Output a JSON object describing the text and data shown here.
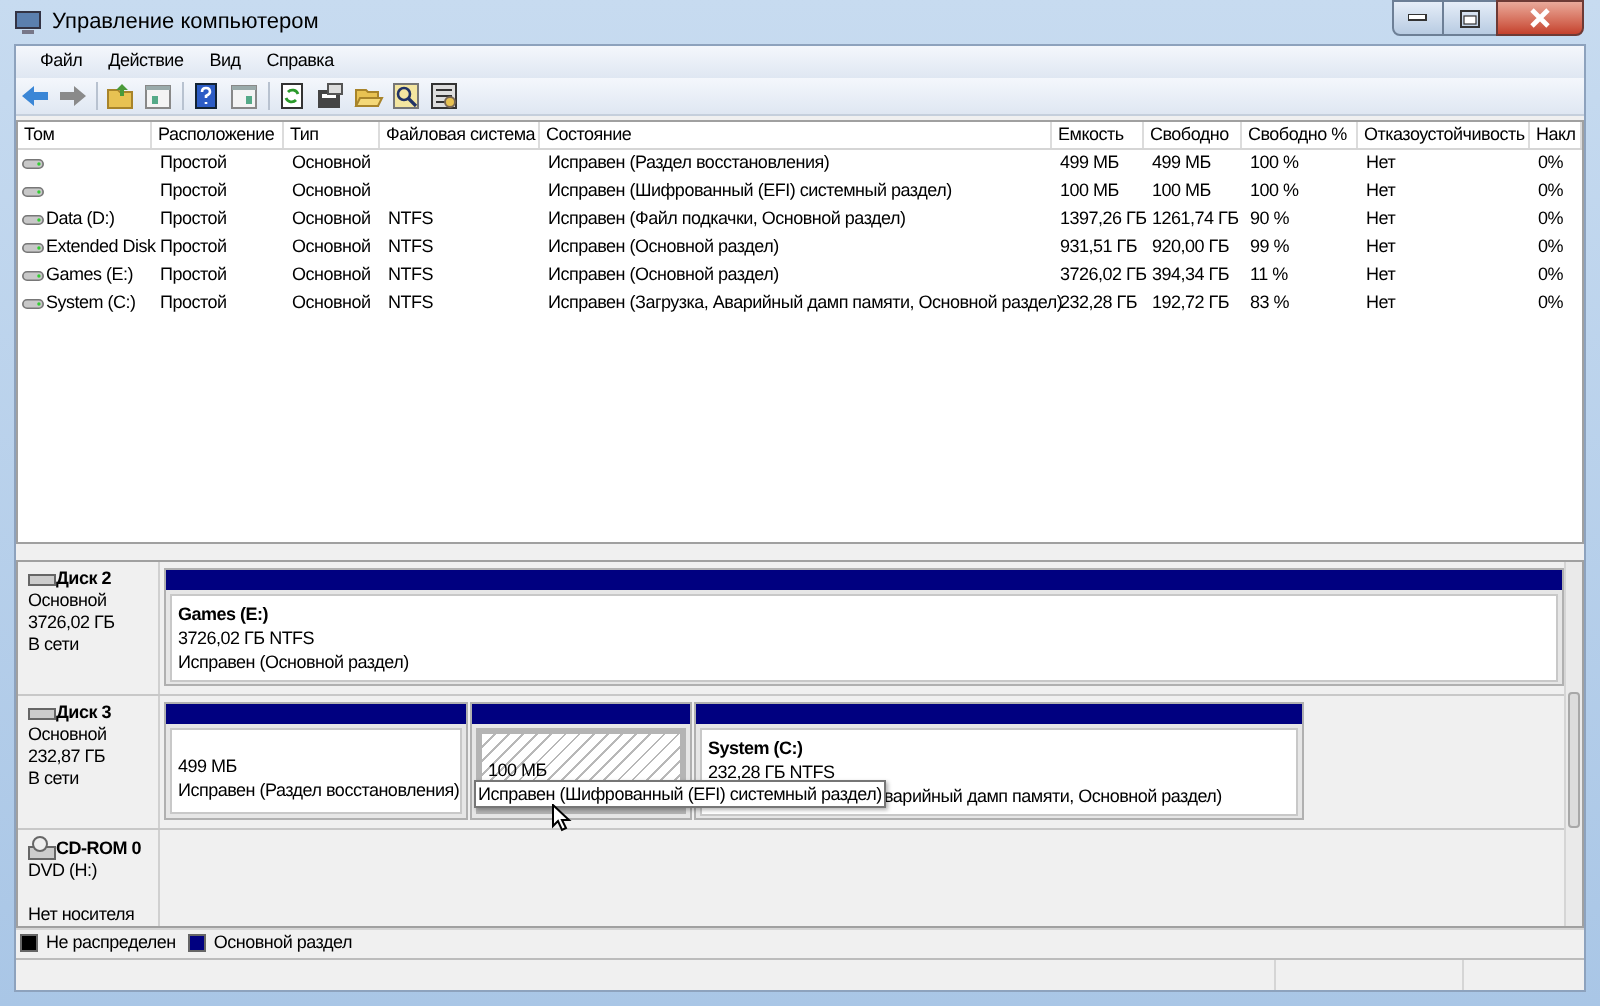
{
  "window": {
    "title": "Управление компьютером"
  },
  "menu": [
    "Файл",
    "Действие",
    "Вид",
    "Справка"
  ],
  "volumes": {
    "columns": [
      "Том",
      "Расположение",
      "Тип",
      "Файловая система",
      "Состояние",
      "Емкость",
      "Свободно",
      "Свободно %",
      "Отказоустойчивость",
      "Накл"
    ],
    "rows": [
      [
        "",
        "Простой",
        "Основной",
        "",
        "Исправен (Раздел восстановления)",
        "499 МБ",
        "499 МБ",
        "100 %",
        "Нет",
        "0%"
      ],
      [
        "",
        "Простой",
        "Основной",
        "",
        "Исправен (Шифрованный (EFI) системный раздел)",
        "100 МБ",
        "100 МБ",
        "100 %",
        "Нет",
        "0%"
      ],
      [
        "Data (D:)",
        "Простой",
        "Основной",
        "NTFS",
        "Исправен (Файл подкачки, Основной раздел)",
        "1397,26 ГБ",
        "1261,74 ГБ",
        "90 %",
        "Нет",
        "0%"
      ],
      [
        "Extended Disk",
        "Простой",
        "Основной",
        "NTFS",
        "Исправен (Основной раздел)",
        "931,51 ГБ",
        "920,00 ГБ",
        "99 %",
        "Нет",
        "0%"
      ],
      [
        "Games (E:)",
        "Простой",
        "Основной",
        "NTFS",
        "Исправен (Основной раздел)",
        "3726,02 ГБ",
        "394,34 ГБ",
        "11 %",
        "Нет",
        "0%"
      ],
      [
        "System (C:)",
        "Простой",
        "Основной",
        "NTFS",
        "Исправен (Загрузка, Аварийный дамп памяти, Основной раздел)",
        "232,28 ГБ",
        "192,72 ГБ",
        "83 %",
        "Нет",
        "0%"
      ]
    ]
  },
  "disks": [
    {
      "kind": "disk",
      "name": "Диск 2",
      "type": "Основной",
      "size": "3726,02 ГБ",
      "state": "В сети",
      "partitions": [
        {
          "name": "Games  (E:)",
          "size": "3726,02 ГБ NTFS",
          "status": "Исправен (Основной раздел)",
          "selected": false
        }
      ]
    },
    {
      "kind": "disk",
      "name": "Диск 3",
      "type": "Основной",
      "size": "232,87 ГБ",
      "state": "В сети",
      "partitions": [
        {
          "size": "499 МБ",
          "status": "Исправен (Раздел восстановления)",
          "selected": false
        },
        {
          "size": "100 МБ",
          "selected": true,
          "tooltip": "Исправен (Шифрованный (EFI) системный раздел)"
        },
        {
          "name": "System  (C:)",
          "size": "232,28 ГБ NTFS",
          "status": "варийный дамп памяти, Основной раздел)",
          "selected": false
        }
      ]
    },
    {
      "kind": "cdrom",
      "name": "CD-ROM 0",
      "type": "DVD (H:)",
      "state": "Нет носителя"
    }
  ],
  "legend": [
    {
      "label": "Не распределен",
      "color": "#000000"
    },
    {
      "label": "Основной раздел",
      "color": "#000080"
    }
  ]
}
